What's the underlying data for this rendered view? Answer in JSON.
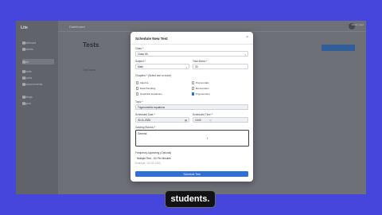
{
  "app": {
    "brand": "Lite",
    "crumb": "Dashboard",
    "user_name": "Admin User",
    "page_title": "Tests",
    "bg_row": "Test Name",
    "sidebar": {
      "items": [
        {
          "label": "Dashboard",
          "icon": "home-icon"
        },
        {
          "label": "Students",
          "icon": "users-icon"
        },
        {
          "label": "Tests",
          "icon": "clipboard-icon"
        },
        {
          "label": "Results",
          "icon": "chart-icon"
        },
        {
          "label": "Reports",
          "icon": "file-icon"
        },
        {
          "label": "Announcements",
          "icon": "megaphone-icon"
        },
        {
          "label": "Settings",
          "icon": "gear-icon"
        },
        {
          "label": "Logout",
          "icon": "logout-icon"
        }
      ]
    }
  },
  "modal": {
    "title": "Schedule New Test",
    "close_glyph": "×",
    "class_label": "Class *",
    "class_value": "Class 9A",
    "subject_label": "Subject *",
    "subject_value": "Math",
    "total_marks_label": "Total Marks *",
    "total_marks_value": "30",
    "chapters_label": "Chapters * (Select one or more)",
    "chapters": [
      {
        "label": "Algebra",
        "checked": false
      },
      {
        "label": "Polynomials",
        "checked": false
      },
      {
        "label": "Data Handling",
        "checked": false
      },
      {
        "label": "Mensuration",
        "checked": false
      },
      {
        "label": "Quadratic Equations",
        "checked": false
      },
      {
        "label": "Trigonometry",
        "checked": true
      }
    ],
    "topic_label": "Topic *",
    "topic_value": "Trigonometric equations",
    "scheduled_date_label": "Scheduled Date *",
    "scheduled_date_value": "30-11-2025",
    "scheduled_time_label": "Scheduled Time *",
    "scheduled_time_value": "10:00",
    "grading_label": "Grading Rubrics *",
    "grading_value": "General",
    "frequency_label": "Frequency Appearing (Optional)",
    "frequency_value": "Multiple Test - 10/ Per Minutes",
    "frequency_hint": "Example: 10/ 20/ 1000",
    "submit_label": "Schedule Test",
    "colors": {
      "accent": "#2f6fd6"
    }
  },
  "subtitle": "students."
}
